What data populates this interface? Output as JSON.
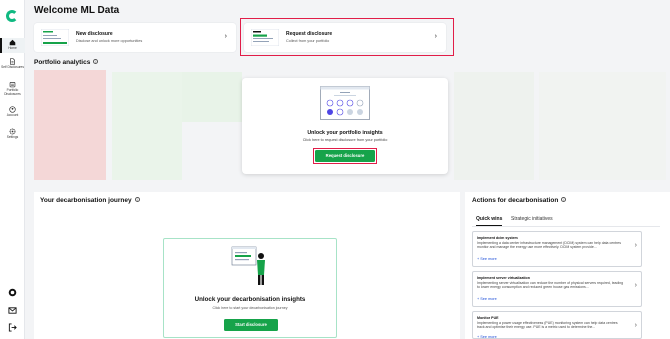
{
  "sidebar": {
    "items": [
      {
        "label": "Home"
      },
      {
        "label": "Self Disclosures"
      },
      {
        "label": "Portfolio Disclosures"
      },
      {
        "label": "Account"
      },
      {
        "label": "Settings"
      }
    ]
  },
  "header": {
    "title": "Welcome ML Data"
  },
  "cards": {
    "new": {
      "title": "New disclosure",
      "subtitle": "Disclose and unlock more opportunities"
    },
    "request": {
      "title": "Request disclosure",
      "subtitle": "Collect from your portfolio"
    }
  },
  "portfolio": {
    "title": "Portfolio analytics",
    "overlay_title": "Unlock your portfolio insights",
    "overlay_subtitle": "Click here to request disclosure from your portfolio",
    "button": "Request disclosure"
  },
  "journey": {
    "title": "Your decarbonisation journey",
    "card_title": "Unlock your decarbonisation insights",
    "card_subtitle": "Click here to start your decarbonisation journey",
    "button": "Start disclosure"
  },
  "actions": {
    "title": "Actions for decarbonisation",
    "tabs": [
      {
        "label": "Quick wins"
      },
      {
        "label": "Strategic initiatives"
      }
    ],
    "items": [
      {
        "title": "Implement dcim system",
        "desc": "Implementing a data center infrastructure management (DCIM) system can help data centres monitor and manage the energy use more effectively. DCIM system provide...",
        "more": "+ See more"
      },
      {
        "title": "Implement server virtualization",
        "desc": "Implementing server virtualisation can reduce the number of physical servers required, leading to lower energy consumption and reduced green house gas emissions...",
        "more": "+ See more"
      },
      {
        "title": "Monitor PUE",
        "desc": "Implementing a power usage effectiveness (PUE) monitoring system can help data centres track and optimise their energy use. PUE is a metric used to determine the...",
        "more": "+ See more"
      }
    ]
  },
  "colors": {
    "accent": "#16a34a",
    "highlight": "#e11d48"
  },
  "icons": [
    "home-icon",
    "document-icon",
    "portfolio-icon",
    "account-icon",
    "settings-icon",
    "support-icon",
    "mail-icon",
    "logout-icon",
    "chevron-right-icon",
    "info-icon"
  ]
}
